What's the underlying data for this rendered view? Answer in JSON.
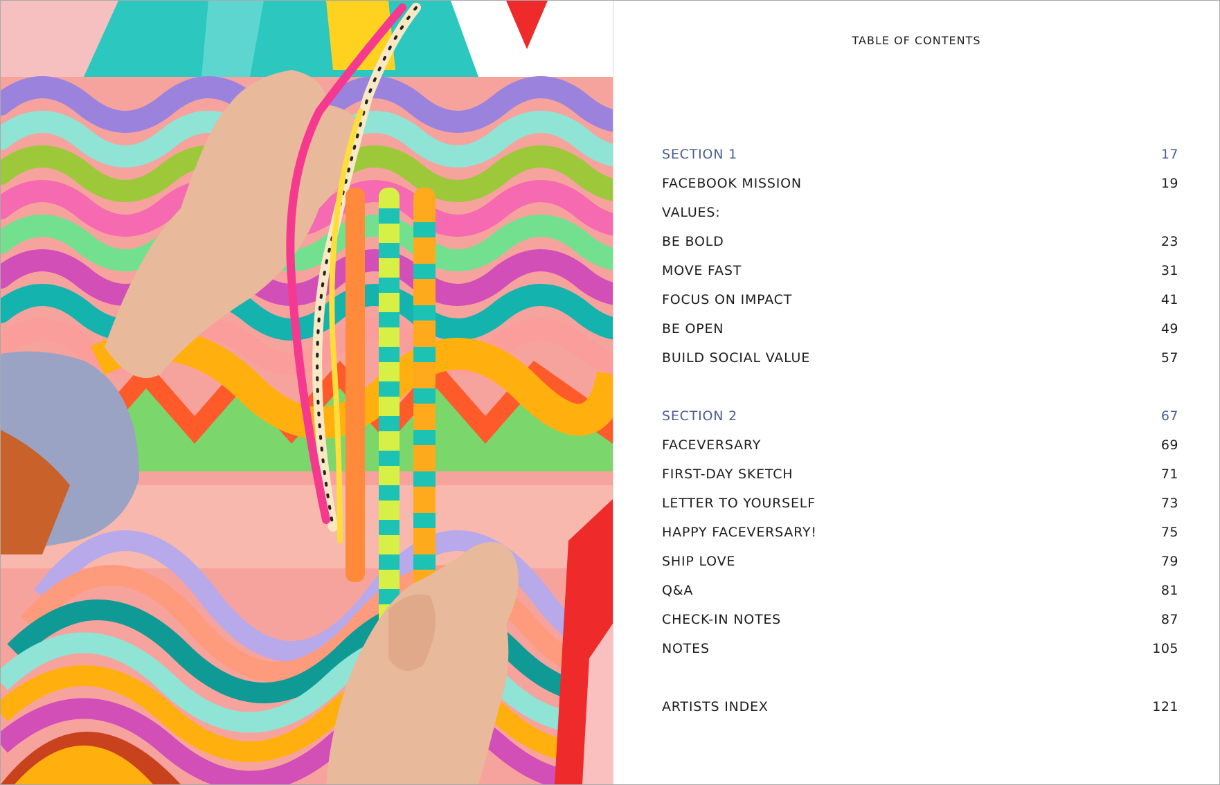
{
  "toc": {
    "title": "TABLE OF CONTENTS",
    "section_color": "#4A5E96",
    "groups": [
      {
        "rows": [
          {
            "label": "SECTION 1",
            "page": "17",
            "is_section": true
          },
          {
            "label": "FACEBOOK MISSION",
            "page": "19"
          },
          {
            "label": "VALUES:",
            "page": ""
          },
          {
            "label": "BE BOLD",
            "page": "23"
          },
          {
            "label": "MOVE FAST",
            "page": "31"
          },
          {
            "label": "FOCUS ON IMPACT",
            "page": "41"
          },
          {
            "label": "BE OPEN",
            "page": "49"
          },
          {
            "label": "BUILD SOCIAL VALUE",
            "page": "57"
          }
        ]
      },
      {
        "rows": [
          {
            "label": "SECTION 2",
            "page": "67",
            "is_section": true
          },
          {
            "label": "FACEVERSARY",
            "page": "69"
          },
          {
            "label": "FIRST-DAY SKETCH",
            "page": "71"
          },
          {
            "label": "LETTER TO YOURSELF",
            "page": "73"
          },
          {
            "label": "HAPPY FACEVERSARY!",
            "page": "75"
          },
          {
            "label": "SHIP LOVE",
            "page": "79"
          },
          {
            "label": "Q&A",
            "page": "81"
          },
          {
            "label": "CHECK-IN NOTES",
            "page": "87"
          },
          {
            "label": "NOTES",
            "page": "105"
          }
        ]
      },
      {
        "rows": [
          {
            "label": "ARTISTS INDEX",
            "page": "121"
          }
        ]
      }
    ]
  }
}
